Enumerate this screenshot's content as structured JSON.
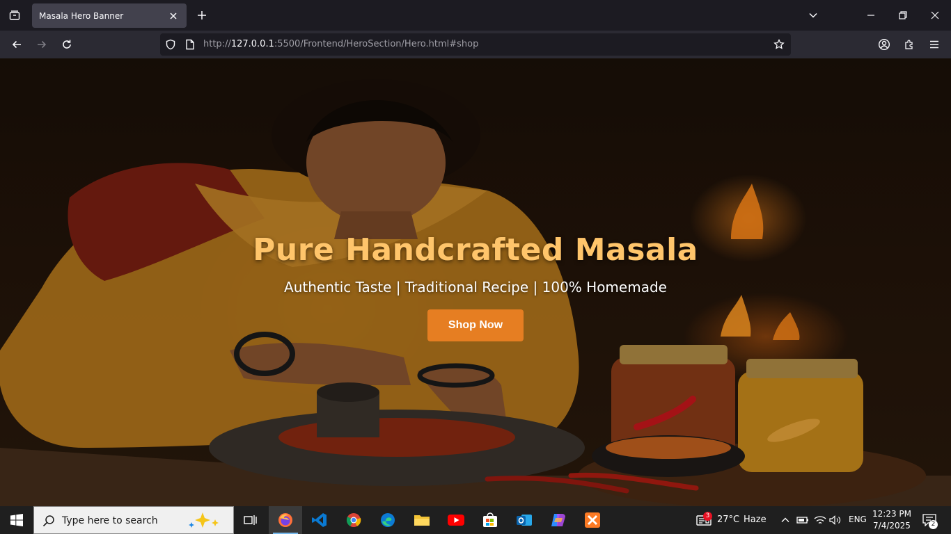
{
  "browser": {
    "tab": {
      "title": "Masala Hero Banner"
    },
    "url": {
      "prefix": "http://",
      "host": "127.0.0.1",
      "rest": ":5500/Frontend/HeroSection/Hero.html#shop"
    }
  },
  "hero": {
    "title": "Pure Handcrafted Masala",
    "subtitle": "Authentic Taste | Traditional Recipe | 100% Homemade",
    "cta_label": "Shop Now",
    "colors": {
      "title": "#ffc56b",
      "cta_bg": "#e67e22",
      "subtitle": "#ffffff"
    },
    "image_description_icons": [
      "woman-grinding-spices",
      "mortar-stone-icon",
      "chili-jar-icon",
      "turmeric-jar-icon",
      "fire-icon"
    ]
  },
  "taskbar": {
    "search_placeholder": "Type here to search",
    "weather": {
      "temp": "27°C",
      "condition": "Haze",
      "badge": "3"
    },
    "language": "ENG",
    "time": "12:23 PM",
    "date": "7/4/2025",
    "notifications": "2",
    "apps": [
      "firefox-icon",
      "vscode-icon",
      "chrome-icon",
      "edge-icon",
      "file-explorer-icon",
      "youtube-icon",
      "store-icon",
      "outlook-icon",
      "copilot-icon",
      "xampp-icon"
    ]
  }
}
